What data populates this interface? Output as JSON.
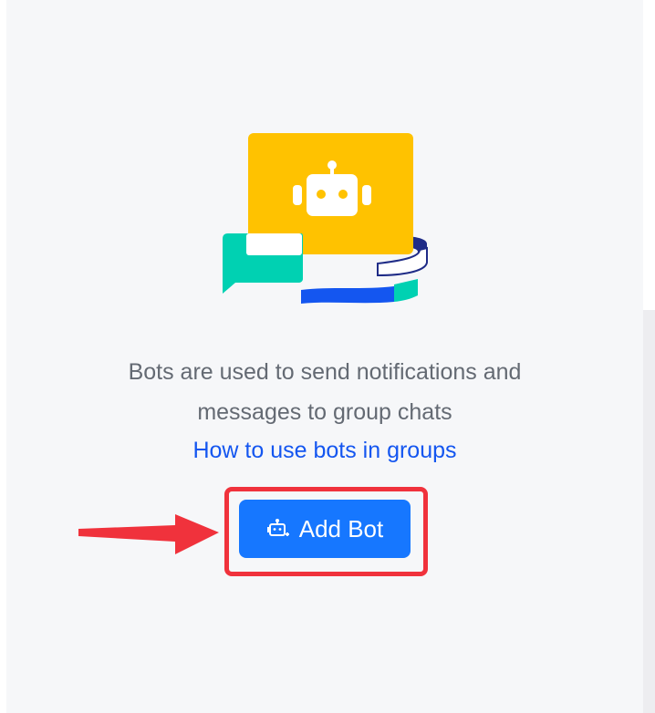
{
  "empty_state": {
    "description_line1": "Bots are used to send notifications and",
    "description_line2": "messages to group chats",
    "help_link": "How to use bots in groups"
  },
  "actions": {
    "add_bot_label": "Add Bot",
    "add_bot_icon": "add-bot-icon"
  },
  "annotation": {
    "highlight_color": "#f0323c",
    "arrow_icon": "arrow-right-icon"
  },
  "colors": {
    "primary": "#1677ff",
    "link": "#1456f0",
    "illustration_yellow": "#ffc200",
    "illustration_teal": "#00d1b2",
    "illustration_navy": "#1f2c87",
    "illustration_blue": "#1456f0"
  }
}
